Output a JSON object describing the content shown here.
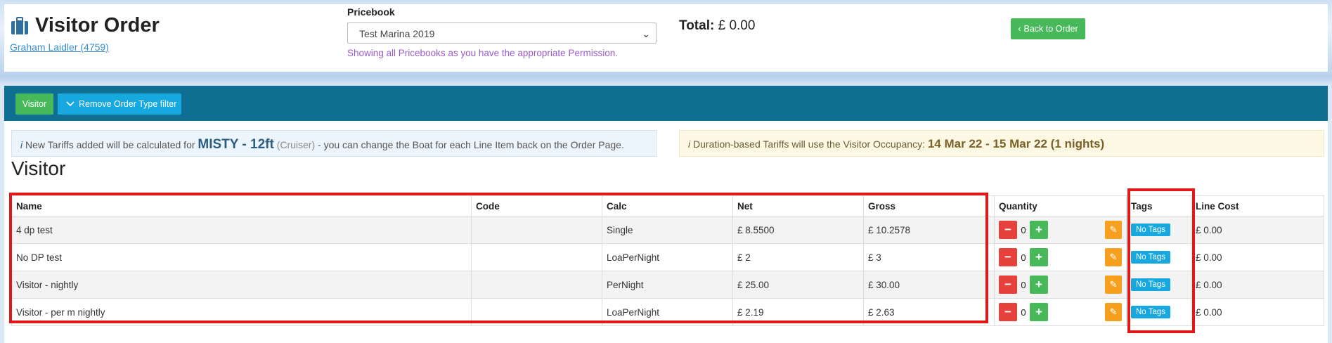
{
  "header": {
    "title": "Visitor Order",
    "owner_link": "Graham Laidler (4759)",
    "pricebook_label": "Pricebook",
    "pricebook_value": "Test Marina 2019",
    "pricebook_note": "Showing all Pricebooks as you have the appropriate Permission.",
    "total_label": "Total:",
    "total_value": "£ 0.00",
    "back_button": "Back to Order"
  },
  "toolbar": {
    "visitor_button": "Visitor",
    "filter_button": "Remove Order Type filter"
  },
  "info": {
    "prefix": "New Tariffs added will be calculated for",
    "boat": "MISTY - 12ft",
    "boat_type": "(Cruiser)",
    "suffix": "- you can change the Boat for each Line Item back on the Order Page."
  },
  "warning": {
    "prefix": "Duration-based Tariffs will use the Visitor Occupancy:",
    "dates": "14 Mar 22 - 15 Mar 22 (1 nights)"
  },
  "section_title": "Visitor",
  "table": {
    "columns": [
      "Name",
      "Code",
      "Calc",
      "Net",
      "Gross",
      "Quantity",
      "Tags",
      "Line Cost"
    ],
    "rows": [
      {
        "name": "4 dp test",
        "code": "",
        "calc": "Single",
        "net": "£ 8.5500",
        "gross": "£ 10.2578",
        "qty": "0",
        "tag": "No Tags",
        "line_cost": "£ 0.00"
      },
      {
        "name": "No DP test",
        "code": "",
        "calc": "LoaPerNight",
        "net": "£ 2",
        "gross": "£ 3",
        "qty": "0",
        "tag": "No Tags",
        "line_cost": "£ 0.00"
      },
      {
        "name": "Visitor - nightly",
        "code": "",
        "calc": "PerNight",
        "net": "£ 25.00",
        "gross": "£ 30.00",
        "qty": "0",
        "tag": "No Tags",
        "line_cost": "£ 0.00"
      },
      {
        "name": "Visitor - per m nightly",
        "code": "",
        "calc": "LoaPerNight",
        "net": "£ 2.19",
        "gross": "£ 2.63",
        "qty": "0",
        "tag": "No Tags",
        "line_cost": "£ 0.00"
      }
    ]
  },
  "colors": {
    "accent_green": "#47b95a",
    "accent_blue": "#16a8df",
    "toolbar_teal": "#0e6f92",
    "highlight_red": "#e01818",
    "edit_orange": "#f5a01f",
    "minus_red": "#e6413a"
  },
  "icons": {
    "title": "suitcase-icon",
    "select": "chevron-down-icon",
    "back": "chevron-left-icon",
    "filter": "chevron-down-icon",
    "info": "info-icon",
    "minus": "minus-icon",
    "plus": "plus-icon",
    "edit": "edit-icon"
  }
}
